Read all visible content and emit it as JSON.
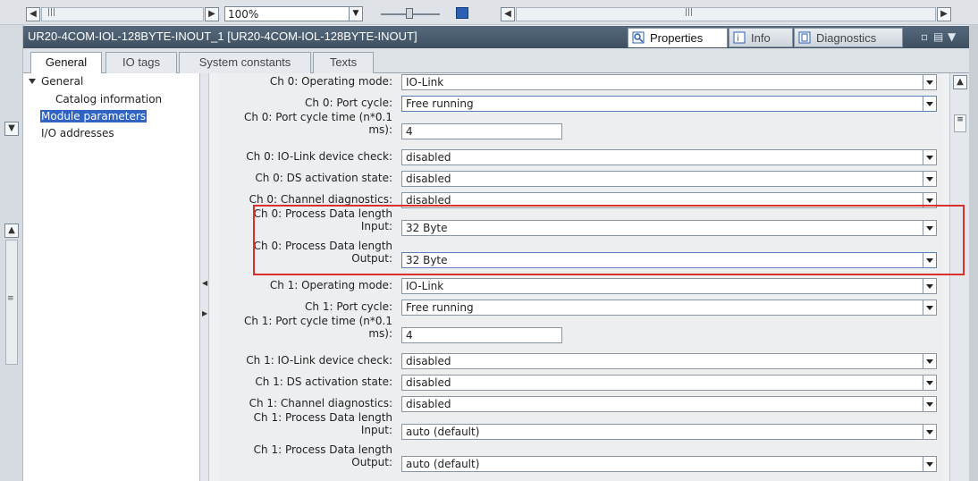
{
  "toolbar": {
    "zoom_value": "100%"
  },
  "title_bar": {
    "title": "UR20-4COM-IOL-128BYTE-INOUT_1  [UR20-4COM-IOL-128BYTE-INOUT]",
    "tabs": [
      {
        "label": "Properties",
        "icon": "properties-icon"
      },
      {
        "label": "Info",
        "icon": "info-icon"
      },
      {
        "label": "Diagnostics",
        "icon": "diagnostics-icon"
      }
    ]
  },
  "subtabs": [
    {
      "label": "General"
    },
    {
      "label": "IO tags"
    },
    {
      "label": "System constants"
    },
    {
      "label": "Texts"
    }
  ],
  "nav": {
    "general": "General",
    "catalog": "Catalog information",
    "module_params": "Module parameters",
    "io_addresses": "I/O addresses"
  },
  "params": [
    {
      "label": "Ch 0: Operating mode:",
      "value": "IO-Link",
      "kind": "select"
    },
    {
      "label": "Ch 0: Port cycle:",
      "value": "Free running",
      "kind": "select"
    },
    {
      "label1": "Ch 0: Port cycle time (n*0.1",
      "label2": "ms):",
      "value": "4",
      "kind": "text"
    },
    {
      "label": "Ch 0: IO-Link device check:",
      "value": "disabled",
      "kind": "select"
    },
    {
      "label": "Ch 0: DS activation state:",
      "value": "disabled",
      "kind": "select"
    },
    {
      "label": "Ch 0: Channel diagnostics:",
      "value": "disabled",
      "kind": "select"
    },
    {
      "label1": "Ch 0: Process Data length",
      "label2": "Input:",
      "value": "32 Byte",
      "kind": "select"
    },
    {
      "label1": "Ch 0: Process Data length",
      "label2": "Output:",
      "value": "32 Byte",
      "kind": "select"
    },
    {
      "label": "Ch 1: Operating mode:",
      "value": "IO-Link",
      "kind": "select"
    },
    {
      "label": "Ch 1: Port cycle:",
      "value": "Free running",
      "kind": "select"
    },
    {
      "label1": "Ch 1: Port cycle time (n*0.1",
      "label2": "ms):",
      "value": "4",
      "kind": "text"
    },
    {
      "label": "Ch 1: IO-Link device check:",
      "value": "disabled",
      "kind": "select"
    },
    {
      "label": "Ch 1: DS activation state:",
      "value": "disabled",
      "kind": "select"
    },
    {
      "label": "Ch 1: Channel diagnostics:",
      "value": "disabled",
      "kind": "select"
    },
    {
      "label1": "Ch 1: Process Data length",
      "label2": "Input:",
      "value": "auto (default)",
      "kind": "select"
    },
    {
      "label1": "Ch 1: Process Data length",
      "label2": "Output:",
      "value": "auto (default)",
      "kind": "select"
    }
  ],
  "colors": {
    "accent": "#2f64c4",
    "highlight": "#d9302c",
    "titlebar": "#4a5b6e"
  }
}
